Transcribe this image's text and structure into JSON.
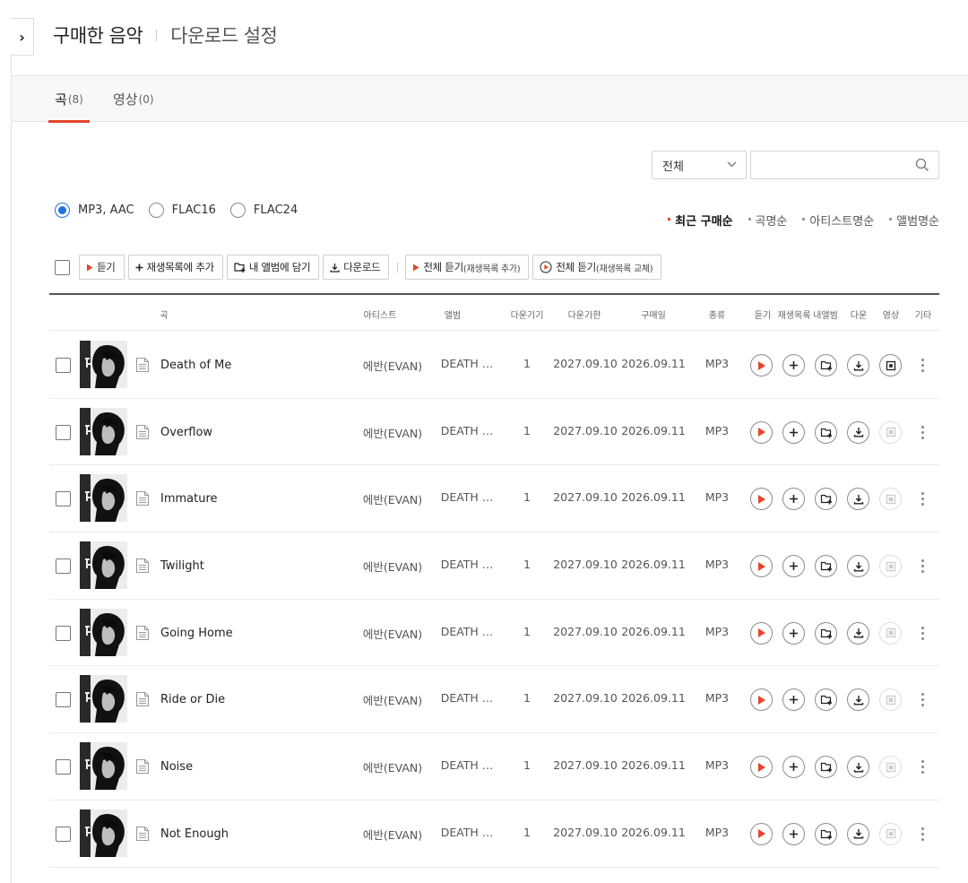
{
  "header": {
    "title": "구매한 음악",
    "subtitle": "다운로드 설정"
  },
  "tabs": [
    {
      "label": "곡",
      "count": "(8)",
      "active": true
    },
    {
      "label": "영상",
      "count": "(0)",
      "active": false
    }
  ],
  "filter": {
    "selected": "전체",
    "search_placeholder": ""
  },
  "formats": [
    {
      "label": "MP3, AAC",
      "selected": true
    },
    {
      "label": "FLAC16",
      "selected": false
    },
    {
      "label": "FLAC24",
      "selected": false
    }
  ],
  "sorts": [
    {
      "label": "최근 구매순",
      "active": true
    },
    {
      "label": "곡명순",
      "active": false
    },
    {
      "label": "아티스트명순",
      "active": false
    },
    {
      "label": "앨범명순",
      "active": false
    }
  ],
  "toolbar": {
    "play": "듣기",
    "add_playlist": "재생목록에 추가",
    "add_album": "내 앨범에 담기",
    "download": "다운로드",
    "play_all": "전체 듣기",
    "play_all_note": "(재생목록 추가)",
    "play_all_replace": "전체 듣기",
    "play_all_replace_note": "(재생목록 교체)"
  },
  "columns": {
    "song": "곡",
    "artist": "아티스트",
    "album": "앨범",
    "downloads": "다운기기",
    "expire": "다운기한",
    "purchased": "구매일",
    "type": "종류",
    "play": "듣기",
    "playlist": "재생목록",
    "myalbum": "내앨범",
    "download": "다운",
    "video": "영상",
    "etc": "기타"
  },
  "songs": [
    {
      "title": "Death of Me",
      "artist": "에반(EVAN)",
      "album": "DEATH …",
      "downloads": "1",
      "expire": "2027.09.10",
      "purchased": "2026.09.11",
      "type": "MP3",
      "video": true
    },
    {
      "title": "Overflow",
      "artist": "에반(EVAN)",
      "album": "DEATH …",
      "downloads": "1",
      "expire": "2027.09.10",
      "purchased": "2026.09.11",
      "type": "MP3",
      "video": false
    },
    {
      "title": "Immature",
      "artist": "에반(EVAN)",
      "album": "DEATH …",
      "downloads": "1",
      "expire": "2027.09.10",
      "purchased": "2026.09.11",
      "type": "MP3",
      "video": false
    },
    {
      "title": "Twilight",
      "artist": "에반(EVAN)",
      "album": "DEATH …",
      "downloads": "1",
      "expire": "2027.09.10",
      "purchased": "2026.09.11",
      "type": "MP3",
      "video": false
    },
    {
      "title": "Going Home",
      "artist": "에반(EVAN)",
      "album": "DEATH …",
      "downloads": "1",
      "expire": "2027.09.10",
      "purchased": "2026.09.11",
      "type": "MP3",
      "video": false
    },
    {
      "title": "Ride or Die",
      "artist": "에반(EVAN)",
      "album": "DEATH …",
      "downloads": "1",
      "expire": "2027.09.10",
      "purchased": "2026.09.11",
      "type": "MP3",
      "video": false
    },
    {
      "title": "Noise",
      "artist": "에반(EVAN)",
      "album": "DEATH …",
      "downloads": "1",
      "expire": "2027.09.10",
      "purchased": "2026.09.11",
      "type": "MP3",
      "video": false
    },
    {
      "title": "Not Enough",
      "artist": "에반(EVAN)",
      "album": "DEATH …",
      "downloads": "1",
      "expire": "2027.09.10",
      "purchased": "2026.09.11",
      "type": "MP3",
      "video": false
    }
  ],
  "icons": {
    "expand": "chevron-right-icon",
    "search": "search-icon",
    "doc": "document-icon",
    "play": "play-icon",
    "add": "plus-icon",
    "album": "add-album-icon",
    "download": "download-icon",
    "video": "video-icon",
    "more": "more-vertical-icon"
  },
  "colors": {
    "accent": "#e5452c",
    "radio": "#1e74e0"
  }
}
